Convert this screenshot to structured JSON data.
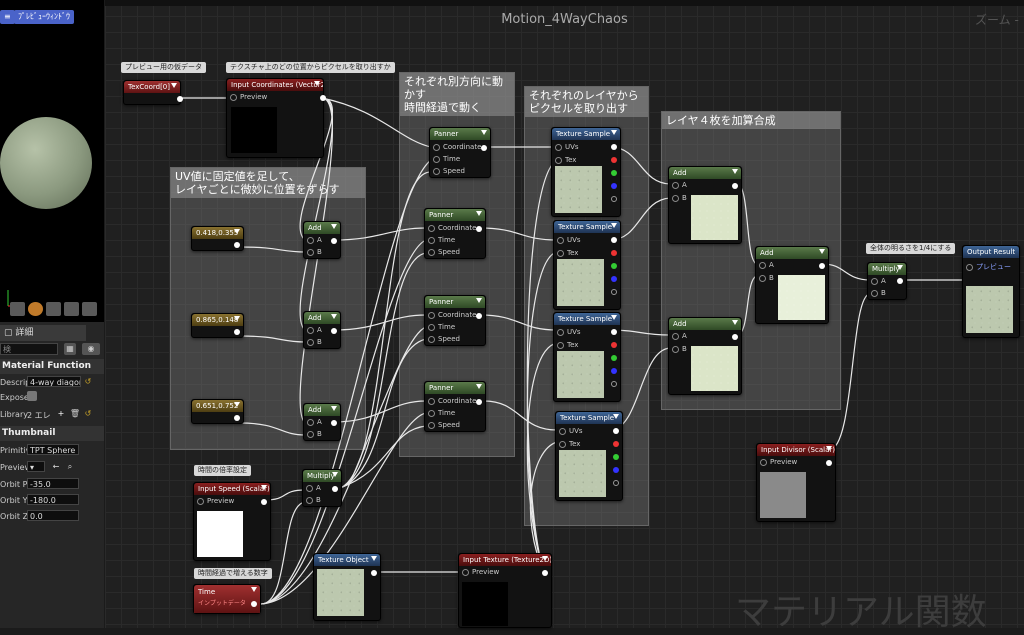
{
  "viewport": {
    "button_label": "ﾌﾟﾚﾋﾞｭｰｳｨﾝﾄﾞｳ"
  },
  "details": {
    "tab_label": "詳細",
    "search_placeholder": "検",
    "material_function": {
      "header": "Material Function",
      "description_label": "Descrip",
      "description_value": "4-way diagona",
      "expose_label": "Expose",
      "library_label": "Library",
      "library_value": "2 エレ"
    },
    "thumbnail": {
      "header": "Thumbnail",
      "primitive_label": "Primitiv",
      "primitive_value": "TPT Sphere",
      "preview_label": "Preview",
      "orbit_pitch_label": "Orbit Pi",
      "orbit_pitch_value": "-35.0",
      "orbit_yaw_label": "Orbit Y",
      "orbit_yaw_value": "-180.0",
      "orbit_zoom_label": "Orbit Z",
      "orbit_zoom_value": "0.0"
    }
  },
  "graph": {
    "title": "Motion_4WayChaos",
    "zoom_label": "ズーム -",
    "watermark": "マテリアル関数"
  },
  "comments": {
    "uv_offset": "UV値に固定値を足して、\nレイヤごとに微妙に位置をずらす",
    "panner_move": "それぞれ別方向に動かす\n時間経過で動く",
    "sample_pixels": "それぞれのレイヤから\nピクセルを取り出す",
    "add_layers": "レイヤ４枚を加算合成",
    "preview_texcoord": "プレビュー用の仮データ",
    "input_coords_note": "テクスチャ上のどの位置からピクセルを取り出すか",
    "time_multiplier": "時間の倍率設定",
    "time_increasing": "時間経過で増える数字",
    "brightness_quarter": "全体の明るさを1/4にする"
  },
  "nodes": {
    "texcoord": {
      "title": "TexCoord[0]"
    },
    "input_coordinates": {
      "title": "Input Coordinates (Vector2)",
      "pin_preview": "Preview"
    },
    "const1": {
      "title": "0.418,0.355"
    },
    "const2": {
      "title": "0.865,0.148"
    },
    "const3": {
      "title": "0.651,0.752"
    },
    "add": {
      "title": "Add",
      "pin_a": "A",
      "pin_b": "B"
    },
    "panner": {
      "title": "Panner",
      "pin_coordinate": "Coordinate",
      "pin_time": "Time",
      "pin_speed": "Speed"
    },
    "texture_sample": {
      "title": "Texture Sample",
      "pin_uvs": "UVs",
      "pin_tex": "Tex"
    },
    "multiply": {
      "title": "Multiply",
      "pin_a": "A",
      "pin_b": "B"
    },
    "input_speed": {
      "title": "Input Speed (Scalar)",
      "pin_preview": "Preview"
    },
    "time": {
      "title": "Time",
      "subtitle": "インプットデータ"
    },
    "texture_object": {
      "title": "Texture Object"
    },
    "input_texture": {
      "title": "Input Texture (Texture2D)",
      "pin_preview": "Preview"
    },
    "input_divisor": {
      "title": "Input Divisor (Scalar)",
      "pin_preview": "Preview"
    },
    "output_result": {
      "title": "Output Result",
      "pin_preview": "プレビュー"
    }
  }
}
